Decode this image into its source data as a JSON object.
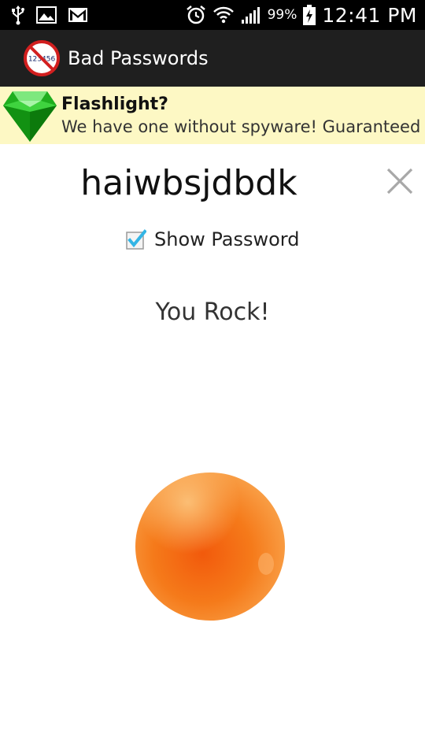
{
  "status_bar": {
    "left_icons": [
      "usb-icon",
      "image-icon",
      "gmail-icon"
    ],
    "right_icons": [
      "alarm-icon",
      "wifi-icon",
      "signal-icon",
      "battery-charging-icon"
    ],
    "battery_percent": "99%",
    "time": "12:41 PM"
  },
  "action_bar": {
    "logo_text": "123456",
    "title": "Bad Passwords"
  },
  "ad": {
    "icon": "green-gem-icon",
    "title": "Flashlight?",
    "subtitle": "We have one without spyware! Guaranteed"
  },
  "password": {
    "value": "haiwbsjdbdk",
    "clear_icon": "close-icon"
  },
  "show_password": {
    "label": "Show Password",
    "checked": true
  },
  "result": {
    "text": "You Rock!"
  },
  "reward": {
    "icon": "orange-icon"
  },
  "colors": {
    "status_bar": "#000000",
    "action_bar": "#1f1f1f",
    "ad_background": "#fdf8c4",
    "checkbox_check": "#33b5e5",
    "orange": "#f57a1a"
  }
}
